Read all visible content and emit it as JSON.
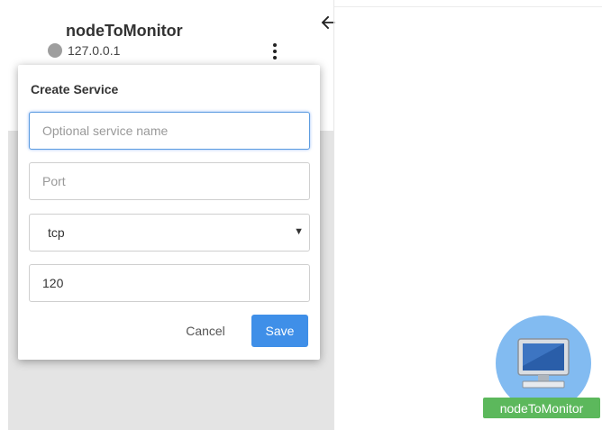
{
  "node": {
    "title": "nodeToMonitor",
    "ip": "127.0.0.1",
    "status_color": "#9e9e9e"
  },
  "dialog": {
    "title": "Create Service",
    "service_name": {
      "value": "",
      "placeholder": "Optional service name"
    },
    "port": {
      "value": "",
      "placeholder": "Port"
    },
    "protocol": {
      "selected": "tcp"
    },
    "interval": {
      "value": "120"
    },
    "cancel_label": "Cancel",
    "save_label": "Save"
  },
  "graph": {
    "node_label": "nodeToMonitor",
    "node_icon": "computer-monitor-icon",
    "node_label_color": "#5cb85c",
    "node_circle_color": "#82bbf1"
  },
  "icons": {
    "back": "arrow-left-icon",
    "menu": "more-vert-icon"
  },
  "colors": {
    "accent": "#3f8fe8",
    "focus": "#5b9be0"
  }
}
